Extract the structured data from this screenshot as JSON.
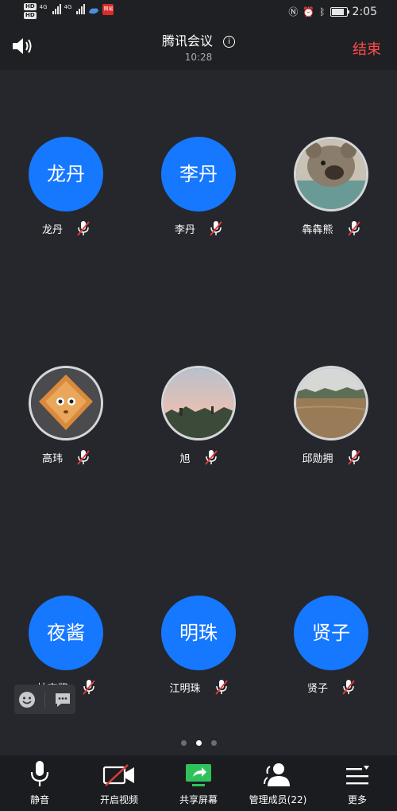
{
  "status_bar": {
    "hd_labels": [
      "HD",
      "HD"
    ],
    "network_labels": [
      "4G",
      "4G"
    ],
    "app_badge_text": "网易",
    "time": "2:05"
  },
  "header": {
    "title": "腾讯会议",
    "duration": "10:28",
    "end_label": "结束"
  },
  "participants": [
    {
      "avatar_text": "龙丹",
      "name": "龙丹"
    },
    {
      "avatar_text": "李丹",
      "name": "李丹"
    },
    {
      "avatar_text": "",
      "name": "犇犇熊"
    },
    {
      "avatar_text": "",
      "name": "高玮"
    },
    {
      "avatar_text": "",
      "name": "旭"
    },
    {
      "avatar_text": "",
      "name": "邱勋拥"
    },
    {
      "avatar_text": "夜酱",
      "name": "柚夜酱"
    },
    {
      "avatar_text": "明珠",
      "name": "江明珠"
    },
    {
      "avatar_text": "贤子",
      "name": "贤子"
    }
  ],
  "pager": {
    "pages": 3,
    "active": 1
  },
  "toolbar": {
    "mute_label": "静音",
    "video_label": "开启视频",
    "share_label": "共享屏幕",
    "members_label": "管理成员(22)",
    "more_label": "更多"
  },
  "colors": {
    "accent": "#1677ff",
    "end": "#ff4c4c",
    "share": "#2fc25b",
    "muted": "#e23b3b"
  }
}
